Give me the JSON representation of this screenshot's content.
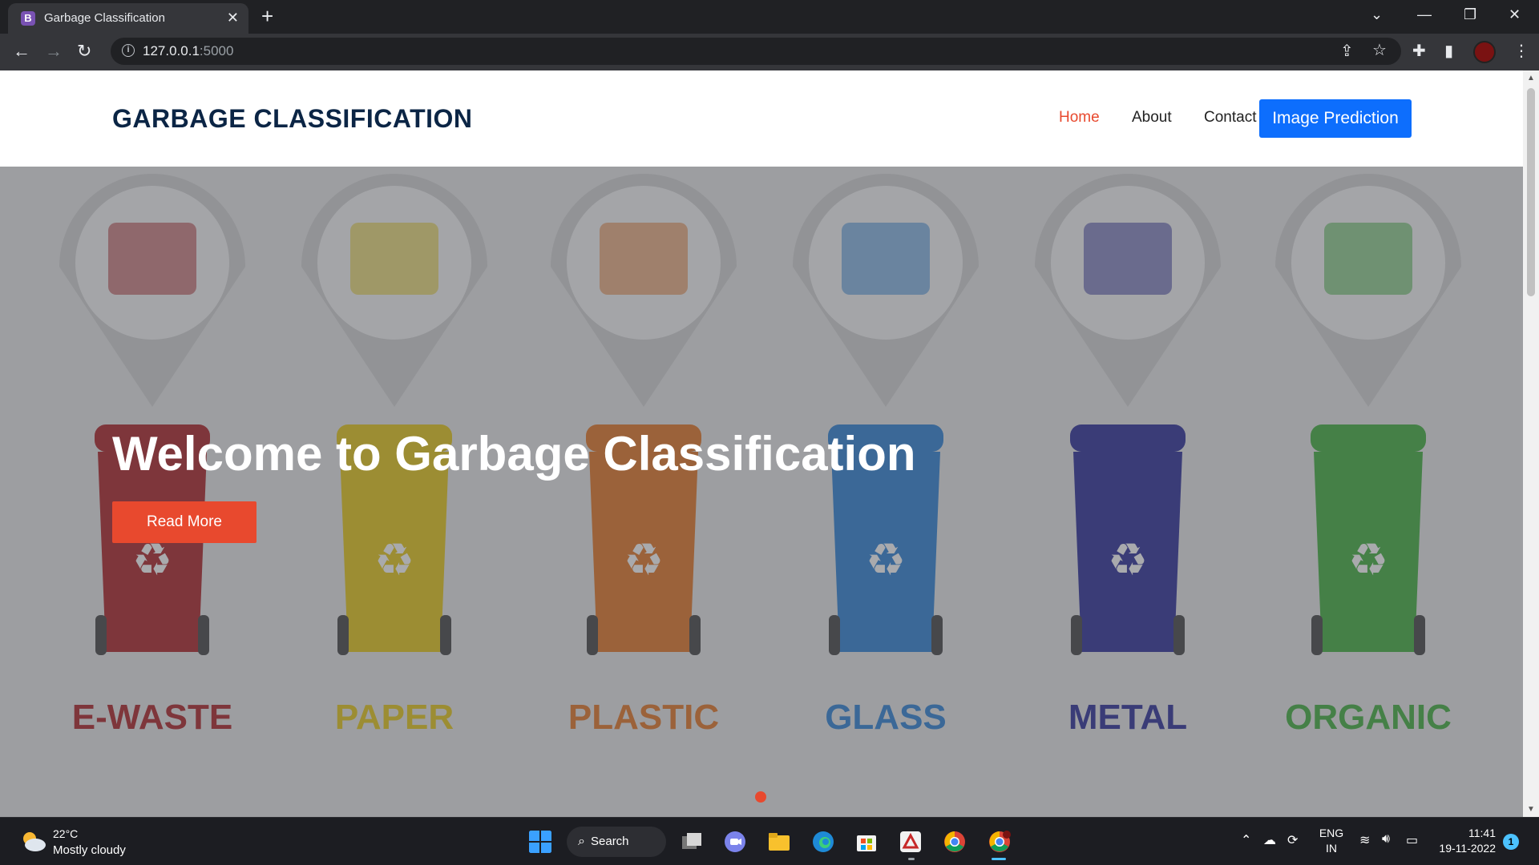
{
  "browser": {
    "tab_title": "Garbage Classification",
    "tab_favicon": "B",
    "url_host": "127.0.0.1",
    "url_port": ":5000"
  },
  "site": {
    "brand": "GARBAGE CLASSIFICATION",
    "nav": {
      "home": "Home",
      "about": "About",
      "contact": "Contact",
      "cta": "Image Prediction"
    },
    "hero": {
      "title": "Welcome to Garbage Classification",
      "button": "Read More",
      "categories": [
        {
          "label": "E-WASTE",
          "color": "#a50d12"
        },
        {
          "label": "PAPER",
          "color": "#e3c300"
        },
        {
          "label": "PLASTIC",
          "color": "#e26a10"
        },
        {
          "label": "GLASS",
          "color": "#1976d2"
        },
        {
          "label": "METAL",
          "color": "#17198f"
        },
        {
          "label": "ORGANIC",
          "color": "#2ea82a"
        }
      ]
    }
  },
  "colors": {
    "accent": "#e8492e",
    "cta": "#0d6efd",
    "brand_text": "#0b2545"
  },
  "taskbar": {
    "weather_temp": "22°C",
    "weather_desc": "Mostly cloudy",
    "search_label": "Search",
    "lang_top": "ENG",
    "lang_bottom": "IN",
    "time": "11:41",
    "date": "19-11-2022",
    "notification_count": "1"
  }
}
